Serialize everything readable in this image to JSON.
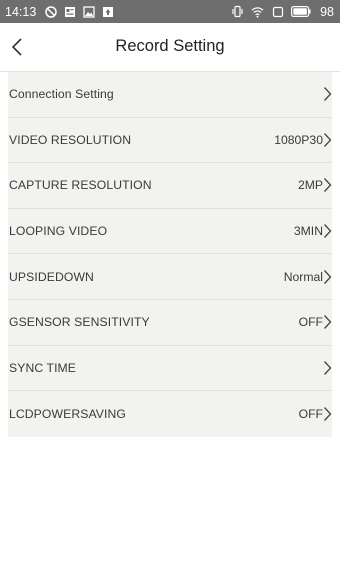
{
  "status_bar": {
    "time": "14:13",
    "battery_level": "98",
    "icons_left": [
      "no-disturb-icon",
      "news-notification-icon",
      "image-notification-icon",
      "download-notification-icon"
    ],
    "icons_right": [
      "vibrate-icon",
      "wifi-icon",
      "battery-outline-icon",
      "battery-icon"
    ]
  },
  "header": {
    "title": "Record Setting"
  },
  "settings": [
    {
      "label": "Connection Setting",
      "value": ""
    },
    {
      "label": "VIDEO RESOLUTION",
      "value": "1080P30"
    },
    {
      "label": "CAPTURE RESOLUTION",
      "value": "2MP"
    },
    {
      "label": "LOOPING VIDEO",
      "value": "3MIN"
    },
    {
      "label": "UPSIDEDOWN",
      "value": "Normal"
    },
    {
      "label": "GSENSOR SENSITIVITY",
      "value": "OFF"
    },
    {
      "label": "SYNC TIME",
      "value": ""
    },
    {
      "label": "LCDPOWERSAVING",
      "value": "OFF"
    }
  ],
  "colors": {
    "status_bar_bg": "#6e6e6e",
    "list_bg": "#f2f2ef",
    "text": "#3a3a3a"
  }
}
